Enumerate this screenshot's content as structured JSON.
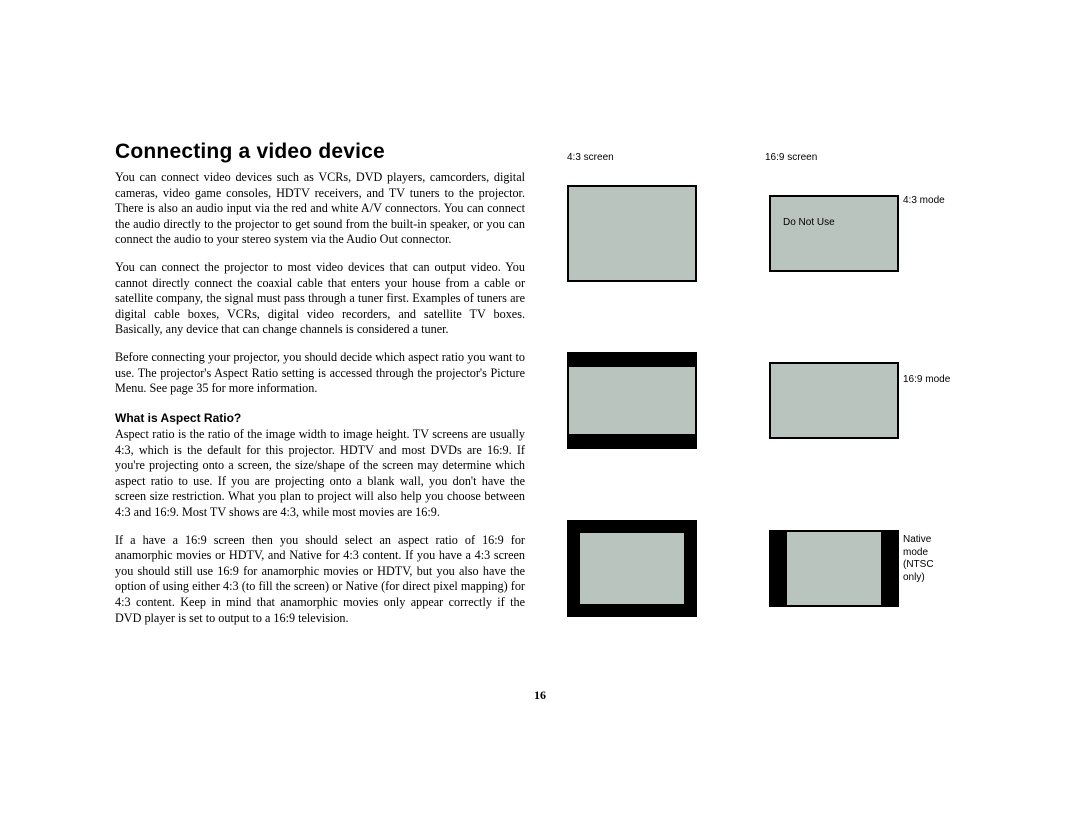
{
  "title": "Connecting a video device",
  "paragraphs": {
    "p1": "You can connect video devices such as VCRs, DVD players, camcorders, digital cameras, video game consoles, HDTV receivers, and TV tuners to the projector. There is also an audio input via the red and white A/V connectors. You can connect the audio directly to the projector to get sound from the built-in speaker, or you can connect the audio to your stereo system via the Audio Out connector.",
    "p2": "You can connect the projector to most video devices that can output video. You cannot directly connect the coaxial cable that enters your house from a cable or satellite company, the signal must pass through a tuner first. Examples of tuners are digital cable boxes, VCRs, digital video recorders, and satellite TV boxes. Basically, any device that can change channels is considered a tuner.",
    "p3": "Before connecting your projector, you should decide which aspect ratio you want to use. The projector's Aspect Ratio setting is accessed through the projector's Picture Menu. See page 35 for more information.",
    "sub": "What is Aspect Ratio?",
    "p4": "Aspect ratio is the ratio of the image width to image height. TV screens are usually 4:3, which is the default for this projector. HDTV and most DVDs are 16:9. If you're projecting onto a screen, the size/shape of the screen may determine which aspect ratio to use. If you are projecting onto a blank wall, you don't have the screen size restriction. What you plan to project will also help you choose between 4:3 and 16:9. Most TV shows are 4:3, while most movies are 16:9.",
    "p5": "If a have a 16:9 screen then you should select an aspect ratio of 16:9 for anamorphic movies or HDTV, and Native for 4:3 content. If you have a 4:3 screen you should still use 16:9 for anamorphic movies or HDTV, but you also have the option of using either 4:3 (to fill the screen) or Native (for direct pixel mapping) for 4:3 content. Keep in mind that anamorphic movies only appear correctly if the DVD player is set to output to a 16:9 television."
  },
  "diagram": {
    "header_left": "4:3 screen",
    "header_right": "16:9 screen",
    "row1_label_right": "4:3 mode",
    "row1_dnu": "Do Not Use",
    "row2_label": "16:9 mode",
    "row3_label": "Native mode (NTSC only)"
  },
  "page_number": "16"
}
